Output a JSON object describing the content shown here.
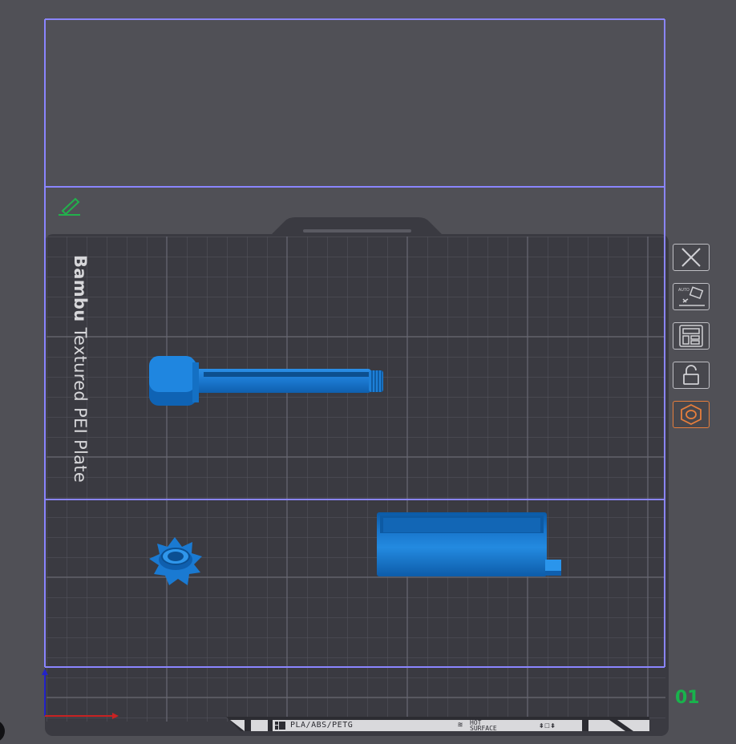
{
  "plate": {
    "name": "Bambu Textured PEI Plate",
    "name_bold": "Bambu",
    "name_rest": " Textured PEI Plate",
    "index": "01",
    "filament_label": "PLA/ABS/PETG",
    "hot_label_line1": "HOT",
    "hot_label_line2": "SURFACE"
  },
  "toolbar": [
    {
      "name": "close-plate-button",
      "icon": "close-icon"
    },
    {
      "name": "auto-orient-button",
      "icon": "auto-orient-icon"
    },
    {
      "name": "arrange-button",
      "icon": "arrange-icon"
    },
    {
      "name": "lock-plate-button",
      "icon": "lock-icon"
    },
    {
      "name": "plate-settings-button",
      "icon": "settings-hexagon-icon",
      "active": true
    }
  ],
  "colors": {
    "background": "#505056",
    "plate": "#3a3a41",
    "grid": "#56565f",
    "bounding_box": "#8a85ff",
    "object": "#1878d0",
    "accent": "#e67e3c",
    "plate_index": "#19b34c"
  }
}
